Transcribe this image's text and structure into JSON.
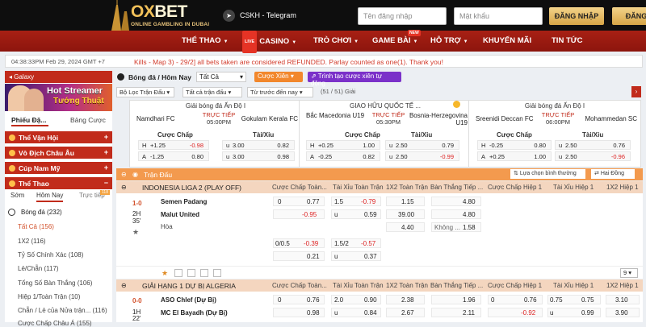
{
  "header": {
    "logo_a": "OX",
    "logo_b": "BET",
    "tagline": "ONLINE GAMBLING IN DUBAI",
    "telegram_icon": "telegram-icon",
    "telegram_label": "CSKH - Telegram",
    "username_placeholder": "Tên đăng nhập",
    "password_placeholder": "Mật khẩu",
    "login_label": "ĐĂNG NHẬP",
    "register_label": "ĐĂNG",
    "accent": "#e7b44c"
  },
  "nav": {
    "items": [
      "THỂ THAO",
      "CASINO",
      "TRÒ CHƠI",
      "GAME BÀI",
      "HỖ TRỢ",
      "KHUYẾN MÃI",
      "TIN TỨC"
    ],
    "live_badge": "LIVE",
    "new_badge": "NEW",
    "bg": "#9b1a10"
  },
  "ticker": {
    "time": "04:38:33PM Feb 29, 2024 GMT +7",
    "text": "Kills - Map 3) - 29/2] all bets taken are considered REFUNDED. Parlay counted as one(1). Thank you!"
  },
  "sidebar": {
    "galaxy": "Galaxy",
    "banner_line1": "Hot Streamer",
    "banner_line2": "Tướng Thuật",
    "tab_a": "Phiếu Đặ...",
    "tab_b": "Bảng Cược",
    "sections": [
      "Thể Vận Hội",
      "Vô Địch Châu Âu",
      "Cúp Nam Mỹ",
      "Thể Thao"
    ],
    "subtabs": [
      "Sớm",
      "Hôm Nay",
      "Trực tiếp"
    ],
    "subtab_badge": "118",
    "sport": "Bóng đá",
    "sport_count": "(232)",
    "bet_types": [
      {
        "label": "Tất Cả",
        "count": "(156)"
      },
      {
        "label": "1X2",
        "count": "(116)"
      },
      {
        "label": "Tỷ Số Chính Xác",
        "count": "(108)"
      },
      {
        "label": "Lẻ/Chẵn",
        "count": "(117)"
      },
      {
        "label": "Tổng Số Bàn Thắng",
        "count": "(106)"
      },
      {
        "label": "Hiệp 1/Toàn Trận",
        "count": "(10)"
      },
      {
        "label": "Chẵn / Lẻ của Nửa trận...",
        "count": "(116)"
      },
      {
        "label": "Cược Chấp Châu Á",
        "count": "(155)"
      }
    ]
  },
  "toolbar": {
    "title": "Bóng đá / Hôm Nay",
    "select": "Tất Cả",
    "parlay_btn": "Cược Xiên",
    "builder_btn": "Trình tạo cược xiên tự động",
    "filter1": "Bộ Lọc Trận Đấu",
    "filter2": "Tất cả trận đấu",
    "filter3": "Từ trước đến nay",
    "count": "(51 / 51) Giải",
    "pager": "›"
  },
  "cards": [
    {
      "league": "Giải bóng đá Ấn Độ I",
      "home": "Namdhari FC",
      "away": "Gokulam Kerala FC",
      "live1": "TRỰC TIẾP",
      "live2": "05:00PM",
      "hd_a": "Cược Chấp",
      "hd_b": "Tài/Xỉu",
      "r1": [
        "H",
        "+1.25",
        "-0.98",
        "u",
        "3.00",
        "0.82"
      ],
      "r2": [
        "A",
        "-1.25",
        "0.80",
        "u",
        "3.00",
        "0.98"
      ]
    },
    {
      "league": "GIAO HỮU QUỐC TẾ ...",
      "home": "Bắc Macedonia U19",
      "away": "Bosnia-Herzegovina U19",
      "live1": "TRỰC TIẾP",
      "live2": "05:30PM",
      "hd_a": "Cược Chấp",
      "hd_b": "Tài/Xỉu",
      "r1": [
        "H",
        "+0.25",
        "1.00",
        "u",
        "2.50",
        "0.79"
      ],
      "r2": [
        "A",
        "-0.25",
        "0.82",
        "u",
        "2.50",
        "-0.99"
      ]
    },
    {
      "league": "Giải bóng đá Ấn Độ I",
      "home": "Sreenidi Deccan FC",
      "away": "Mohammedan SC",
      "live1": "TRỰC TIẾP",
      "live2": "06:00PM",
      "hd_a": "Cược Chấp",
      "hd_b": "Tài/Xỉu",
      "r1": [
        "H",
        "-0.25",
        "0.80",
        "u",
        "2.50",
        "0.76"
      ],
      "r2": [
        "A",
        "+0.25",
        "1.00",
        "u",
        "2.50",
        "-0.96"
      ]
    }
  ],
  "table": {
    "bar_label": "Trận Đấu",
    "sort_btn": "Lựa chọn bình thường",
    "odds_btn": "Hai Đồng",
    "columns": [
      "Cược Chấp Toàn...",
      "Tài Xỉu Toàn Trận",
      "1X2 Toàn Trận",
      "Bàn Thắng Tiếp ...",
      "Cược Chấp Hiệp 1",
      "Tài Xỉu Hiệp 1",
      "1X2 Hiệp 1"
    ],
    "league1": "INDONESIA LIGA 2 (PLAY OFF)",
    "match1": {
      "score": "1-0",
      "half": "2H",
      "minute": "35'",
      "home": "Semen Padang",
      "away": "Malut United",
      "draw": "Hòa",
      "hdp": [
        "0",
        "0.77",
        "-0.95",
        "0/0.5",
        "-0.39",
        "0.21"
      ],
      "ou": [
        "1.5",
        "-0.79",
        "u",
        "0.59",
        "1.5/2",
        "-0.57",
        "u",
        "0.37"
      ],
      "x12": [
        "1.15",
        "39.00",
        "4.40"
      ],
      "next": [
        "4.80",
        "4.80",
        "Không ...",
        "1.58"
      ],
      "page": "9"
    },
    "league2": "GIẢI HẠNG 1 DỰ BỊ ALGERIA",
    "match2": {
      "score": "0-0",
      "half": "1H",
      "minute": "22'",
      "home": "ASO Chlef (Dự Bị)",
      "away": "MC El Bayadh (Dự Bị)",
      "hdp": [
        "0",
        "0.76",
        "0.98"
      ],
      "ou": [
        "2.0",
        "0.90",
        "u",
        "0.84"
      ],
      "x12": [
        "2.38",
        "2.67"
      ],
      "next": [
        "1.96",
        "2.11"
      ],
      "hdp1": [
        "0",
        "0.76",
        "-0.92"
      ],
      "ou1": [
        "0.75",
        "0.75",
        "u",
        "0.99"
      ],
      "x121": [
        "3.10",
        "3.90"
      ]
    }
  }
}
